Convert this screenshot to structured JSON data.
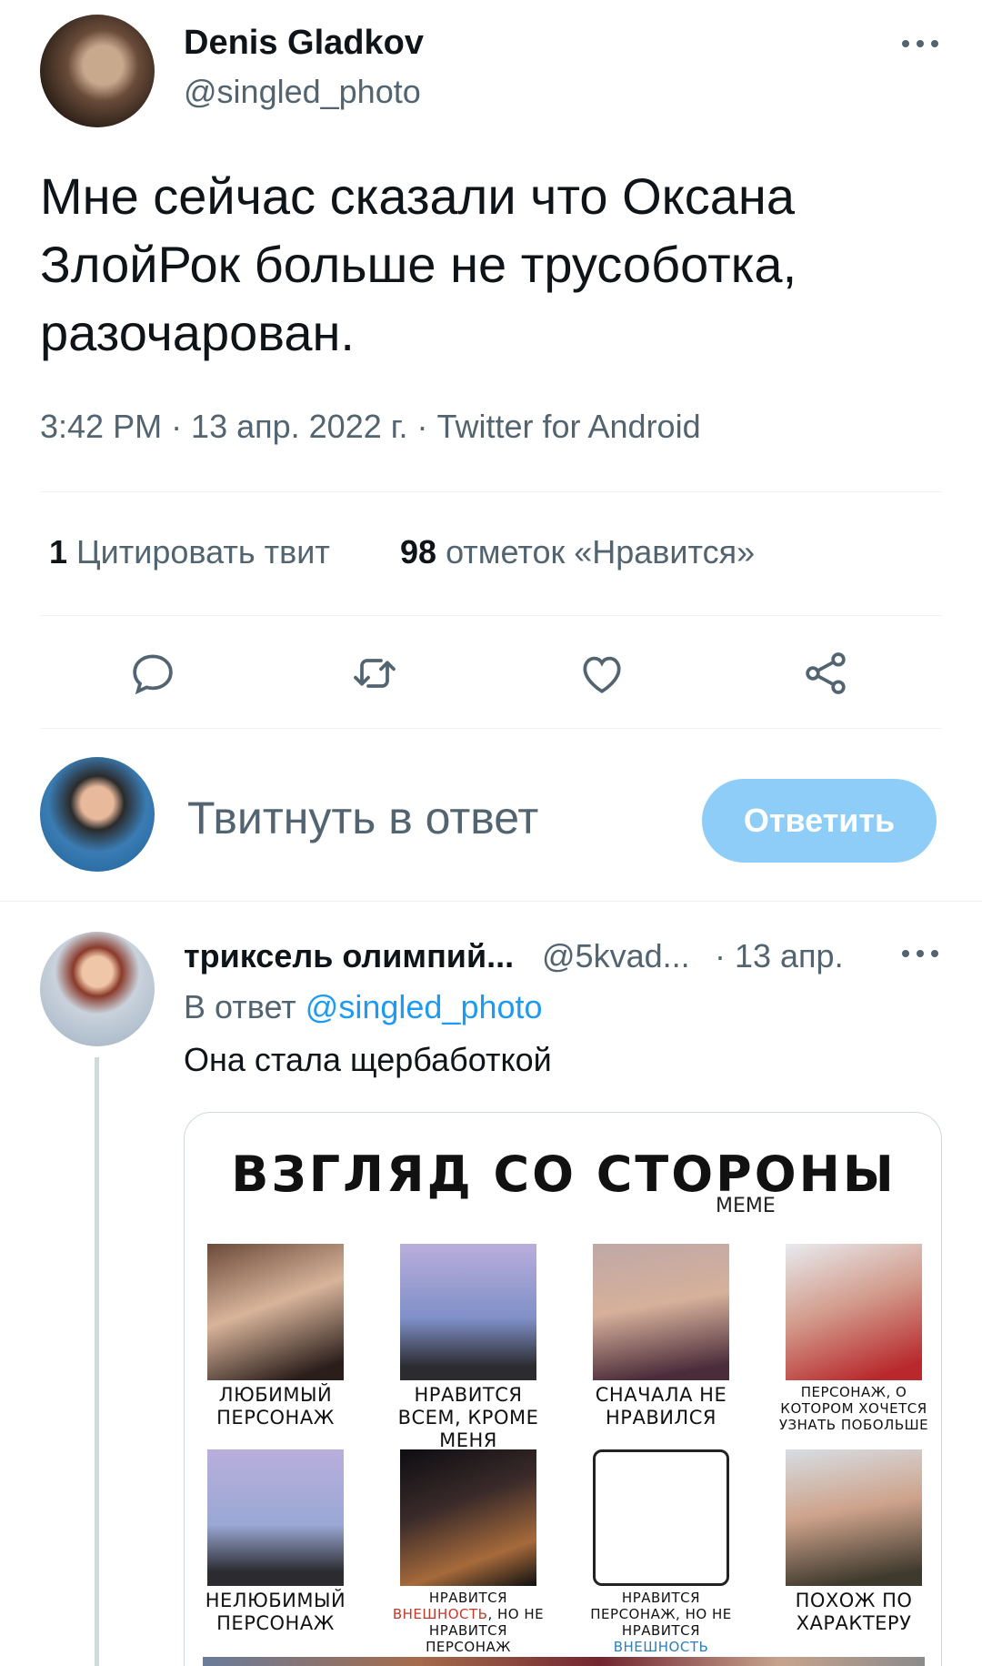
{
  "tweet": {
    "author_name": "Denis Gladkov",
    "author_handle": "@singled_photo",
    "text": "Мне сейчас сказали что Оксана\nЗлойРок больше не трусоботка,\nразочарован.",
    "meta": "3:42 PM · 13 апр. 2022 г. · Twitter for Android",
    "quotes_count": "1",
    "quotes_label": "Цитировать твит",
    "likes_count": "98",
    "likes_label": "отметок «Нравится»"
  },
  "actions": [
    {
      "icon": "reply-icon"
    },
    {
      "icon": "retweet-icon"
    },
    {
      "icon": "like-icon"
    },
    {
      "icon": "share-icon"
    }
  ],
  "composer": {
    "placeholder": "Твитнуть в ответ",
    "button_label": "Ответить"
  },
  "reply": {
    "author_name": "триксель олимпий...",
    "author_handle": "@5kvad...",
    "date": "· 13 апр.",
    "replying_to_prefix": "В ответ",
    "replying_to_handle": "@singled_photo",
    "text": "Она стала щербаботкой"
  },
  "meme": {
    "title": "ВЗГЛЯД СО СТОРОНЫ",
    "subtitle": "MEME",
    "captions": [
      "ЛЮБИМЫЙ ПЕРСОНАЖ",
      "НРАВИТСЯ ВСЕМ, КРОМЕ МЕНЯ",
      "СНАЧАЛА НЕ НРАВИЛСЯ",
      "ПЕРСОНАЖ, О КОТОРОМ ХОЧЕТСЯ УЗНАТЬ ПОБОЛЬШЕ",
      "НЕЛЮБИМЫЙ ПЕРСОНАЖ",
      "НРАВИТСЯ",
      "ВНЕШНОСТЬ",
      ", НО НЕ НРАВИТСЯ ПЕРСОНАЖ",
      "НРАВИТСЯ ПЕРСОНАЖ, НО НЕ НРАВИТСЯ",
      "ВНЕШНОСТЬ",
      "ПОХОЖ ПО ХАРАКТЕРУ"
    ]
  },
  "colors": {
    "accent": "#1d9bf0",
    "button_disabled": "#8ecdf8",
    "secondary_text": "#536471",
    "primary_text": "#0f1419"
  }
}
